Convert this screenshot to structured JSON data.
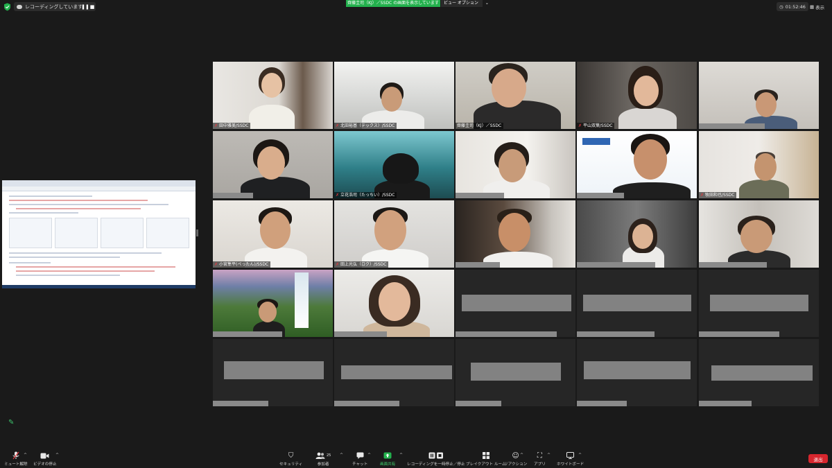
{
  "top_bar": {
    "recording_text": "レコーディングしています...",
    "pause_icon": "❚❚",
    "stop_icon": "■",
    "share_banner": "齊藤圭司（KJ）／SSDC の画面を表示しています",
    "view_options": "ビュー オプション",
    "timer": "01:52:46",
    "view_label": "表示"
  },
  "participants": [
    {
      "name": "田中雅美/SSDC",
      "muted": true
    },
    {
      "name": "北田裕基（テックス）/SSDC",
      "muted": true
    },
    {
      "name": "齊藤圭司（KJ）／SSDC",
      "muted": false
    },
    {
      "name": "平山双葉/SSDC",
      "muted": true
    },
    {
      "name": "",
      "muted": false
    },
    {
      "name": "",
      "muted": false
    },
    {
      "name": "立花浩司（たっちい）/SSDC",
      "muted": true
    },
    {
      "name": "",
      "muted": false
    },
    {
      "name": "",
      "muted": false
    },
    {
      "name": "牧田和也/SSDC",
      "muted": true
    },
    {
      "name": "小宮隼平(ぺったん)/SSDC",
      "muted": true
    },
    {
      "name": "田上光弘（ロク）/SSDC",
      "muted": true
    },
    {
      "name": "",
      "muted": false
    },
    {
      "name": "",
      "muted": false
    },
    {
      "name": "",
      "muted": false
    },
    {
      "name": "",
      "muted": false
    },
    {
      "name": "",
      "muted": false
    }
  ],
  "toolbar": {
    "unmute": "ミュート解除",
    "stop_video": "ビデオの停止",
    "security": "セキュリティ",
    "participants": "参加者",
    "participants_count": "25",
    "chat": "チャット",
    "share_screen": "画面共有",
    "pause_recording": "レコーディングを一時停止／停止",
    "breakout": "ブレイクアウト ルーム",
    "reactions": "リアクション",
    "apps": "アプリ",
    "whiteboard": "ホワイトボード",
    "leave": "退出"
  },
  "colors": {
    "share_banner": "#23b14d",
    "speaker_outline": "#b7d83c",
    "leave": "#d7262e",
    "muted_icon": "#e0393e"
  }
}
